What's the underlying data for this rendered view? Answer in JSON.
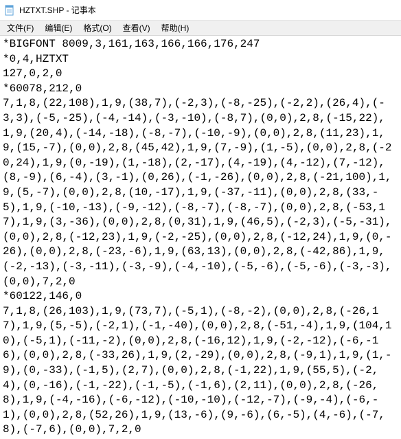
{
  "window": {
    "title": "HZTXT.SHP - 记事本"
  },
  "menu": {
    "file": "文件(F)",
    "edit": "编辑(E)",
    "format": "格式(O)",
    "view": "查看(V)",
    "help": "帮助(H)"
  },
  "content": {
    "lines": [
      "*BIGFONT 8009,3,161,163,166,166,176,247",
      "*0,4,HZTXT",
      "127,0,2,0",
      "*60078,212,0",
      "7,1,8,(22,108),1,9,(38,7),(-2,3),(-8,-25),(-2,2),(26,4),(-3,3),(-5,-25),(-4,-14),(-3,-10),(-8,7),(0,0),2,8,(-15,22),1,9,(20,4),(-14,-18),(-8,-7),(-10,-9),(0,0),2,8,(11,23),1,9,(15,-7),(0,0),2,8,(45,42),1,9,(7,-9),(1,-5),(0,0),2,8,(-20,24),1,9,(0,-19),(1,-18),(2,-17),(4,-19),(4,-12),(7,-12),(8,-9),(6,-4),(3,-1),(0,26),(-1,-26),(0,0),2,8,(-21,100),1,9,(5,-7),(0,0),2,8,(10,-17),1,9,(-37,-11),(0,0),2,8,(33,-5),1,9,(-10,-13),(-9,-12),(-8,-7),(-8,-7),(0,0),2,8,(-53,17),1,9,(3,-36),(0,0),2,8,(0,31),1,9,(46,5),(-2,3),(-5,-31),(0,0),2,8,(-12,23),1,9,(-2,-25),(0,0),2,8,(-12,24),1,9,(0,-26),(0,0),2,8,(-23,-6),1,9,(63,13),(0,0),2,8,(-42,86),1,9,(-2,-13),(-3,-11),(-3,-9),(-4,-10),(-5,-6),(-5,-6),(-3,-3),(0,0),7,2,0",
      "*60122,146,0",
      "7,1,8,(26,103),1,9,(73,7),(-5,1),(-8,-2),(0,0),2,8,(-26,17),1,9,(5,-5),(-2,1),(-1,-40),(0,0),2,8,(-51,-4),1,9,(104,10),(-5,1),(-11,-2),(0,0),2,8,(-16,12),1,9,(-2,-12),(-6,-16),(0,0),2,8,(-33,26),1,9,(2,-29),(0,0),2,8,(-9,1),1,9,(1,-9),(0,-33),(-1,5),(2,7),(0,0),2,8,(-1,22),1,9,(55,5),(-2,4),(0,-16),(-1,-22),(-1,-5),(-1,6),(2,11),(0,0),2,8,(-26,8),1,9,(-4,-16),(-6,-12),(-10,-10),(-12,-7),(-9,-4),(-6,-1),(0,0),2,8,(52,26),1,9,(13,-6),(9,-6),(6,-5),(4,-6),(-7,8),(-7,6),(0,0),7,2,0"
    ]
  }
}
